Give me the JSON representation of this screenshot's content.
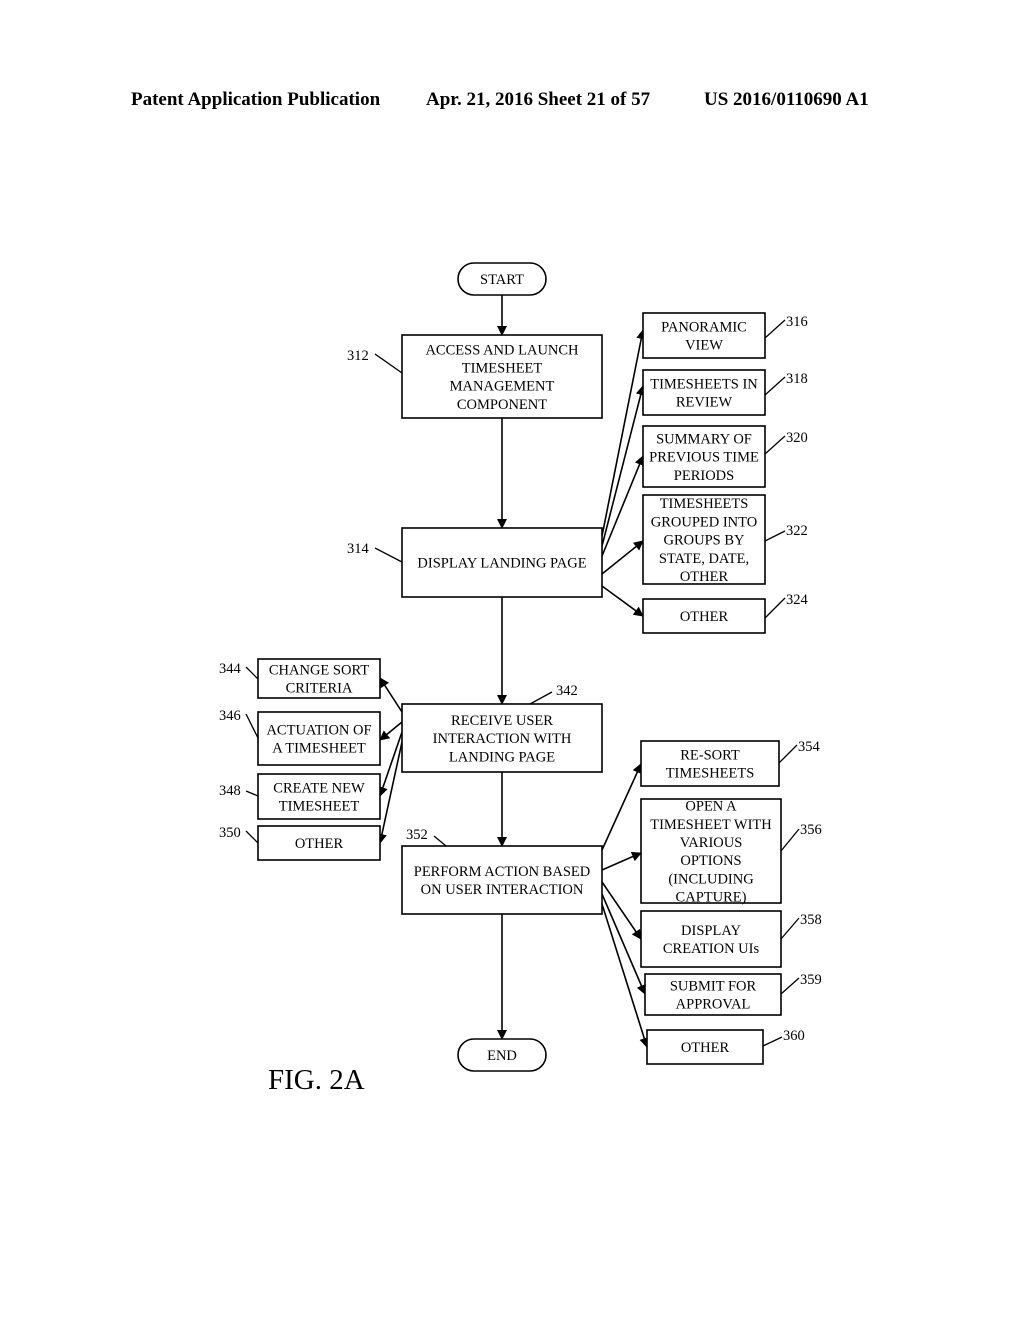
{
  "header": {
    "left": "Patent Application Publication",
    "middle": "Apr. 21, 2016  Sheet 21 of 57",
    "right": "US 2016/0110690 A1"
  },
  "figure_label": "FIG. 2A",
  "diagram": {
    "nodes": [
      {
        "id": "start",
        "type": "terminal",
        "lines": [
          "START"
        ],
        "ref": ""
      },
      {
        "id": "n312",
        "type": "process",
        "lines": [
          "ACCESS AND LAUNCH",
          "TIMESHEET",
          "MANAGEMENT",
          "COMPONENT"
        ],
        "ref": "312"
      },
      {
        "id": "n314",
        "type": "process",
        "lines": [
          "DISPLAY LANDING PAGE"
        ],
        "ref": "314"
      },
      {
        "id": "n316",
        "type": "process",
        "lines": [
          "PANORAMIC",
          "VIEW"
        ],
        "ref": "316"
      },
      {
        "id": "n318",
        "type": "process",
        "lines": [
          "TIMESHEETS IN",
          "REVIEW"
        ],
        "ref": "318"
      },
      {
        "id": "n320",
        "type": "process",
        "lines": [
          "SUMMARY OF",
          "PREVIOUS TIME",
          "PERIODS"
        ],
        "ref": "320"
      },
      {
        "id": "n322",
        "type": "process",
        "lines": [
          "TIMESHEETS",
          "GROUPED INTO",
          "GROUPS BY",
          "STATE, DATE,",
          "OTHER"
        ],
        "ref": "322"
      },
      {
        "id": "n324",
        "type": "process",
        "lines": [
          "OTHER"
        ],
        "ref": "324"
      },
      {
        "id": "n342",
        "type": "process",
        "lines": [
          "RECEIVE USER",
          "INTERACTION WITH",
          "LANDING PAGE"
        ],
        "ref": "342"
      },
      {
        "id": "n344",
        "type": "process",
        "lines": [
          "CHANGE SORT",
          "CRITERIA"
        ],
        "ref": "344"
      },
      {
        "id": "n346",
        "type": "process",
        "lines": [
          "ACTUATION OF",
          "A TIMESHEET"
        ],
        "ref": "346"
      },
      {
        "id": "n348",
        "type": "process",
        "lines": [
          "CREATE NEW",
          "TIMESHEET"
        ],
        "ref": "348"
      },
      {
        "id": "n350",
        "type": "process",
        "lines": [
          "OTHER"
        ],
        "ref": "350"
      },
      {
        "id": "n352",
        "type": "process",
        "lines": [
          "PERFORM ACTION BASED",
          "ON USER INTERACTION"
        ],
        "ref": "352"
      },
      {
        "id": "n354",
        "type": "process",
        "lines": [
          "RE-SORT",
          "TIMESHEETS"
        ],
        "ref": "354"
      },
      {
        "id": "n356",
        "type": "process",
        "lines": [
          "OPEN A",
          "TIMESHEET WITH",
          "VARIOUS",
          "OPTIONS",
          "(INCLUDING",
          "CAPTURE)"
        ],
        "ref": "356"
      },
      {
        "id": "n358",
        "type": "process",
        "lines": [
          "DISPLAY",
          "CREATION UIs"
        ],
        "ref": "358"
      },
      {
        "id": "n359",
        "type": "process",
        "lines": [
          "SUBMIT FOR",
          "APPROVAL"
        ],
        "ref": "359"
      },
      {
        "id": "n360",
        "type": "process",
        "lines": [
          "OTHER"
        ],
        "ref": "360"
      },
      {
        "id": "end",
        "type": "terminal",
        "lines": [
          "END"
        ],
        "ref": ""
      }
    ],
    "edges": [
      {
        "from": "start",
        "to": "n312"
      },
      {
        "from": "n312",
        "to": "n314"
      },
      {
        "from": "n314",
        "to": "n316"
      },
      {
        "from": "n314",
        "to": "n318"
      },
      {
        "from": "n314",
        "to": "n320"
      },
      {
        "from": "n314",
        "to": "n322"
      },
      {
        "from": "n314",
        "to": "n324"
      },
      {
        "from": "n314",
        "to": "n342"
      },
      {
        "from": "n342",
        "to": "n344"
      },
      {
        "from": "n342",
        "to": "n346"
      },
      {
        "from": "n342",
        "to": "n348"
      },
      {
        "from": "n342",
        "to": "n350"
      },
      {
        "from": "n342",
        "to": "n352"
      },
      {
        "from": "n352",
        "to": "n354"
      },
      {
        "from": "n352",
        "to": "n356"
      },
      {
        "from": "n352",
        "to": "n358"
      },
      {
        "from": "n352",
        "to": "n359"
      },
      {
        "from": "n352",
        "to": "n360"
      },
      {
        "from": "n352",
        "to": "end"
      }
    ]
  }
}
